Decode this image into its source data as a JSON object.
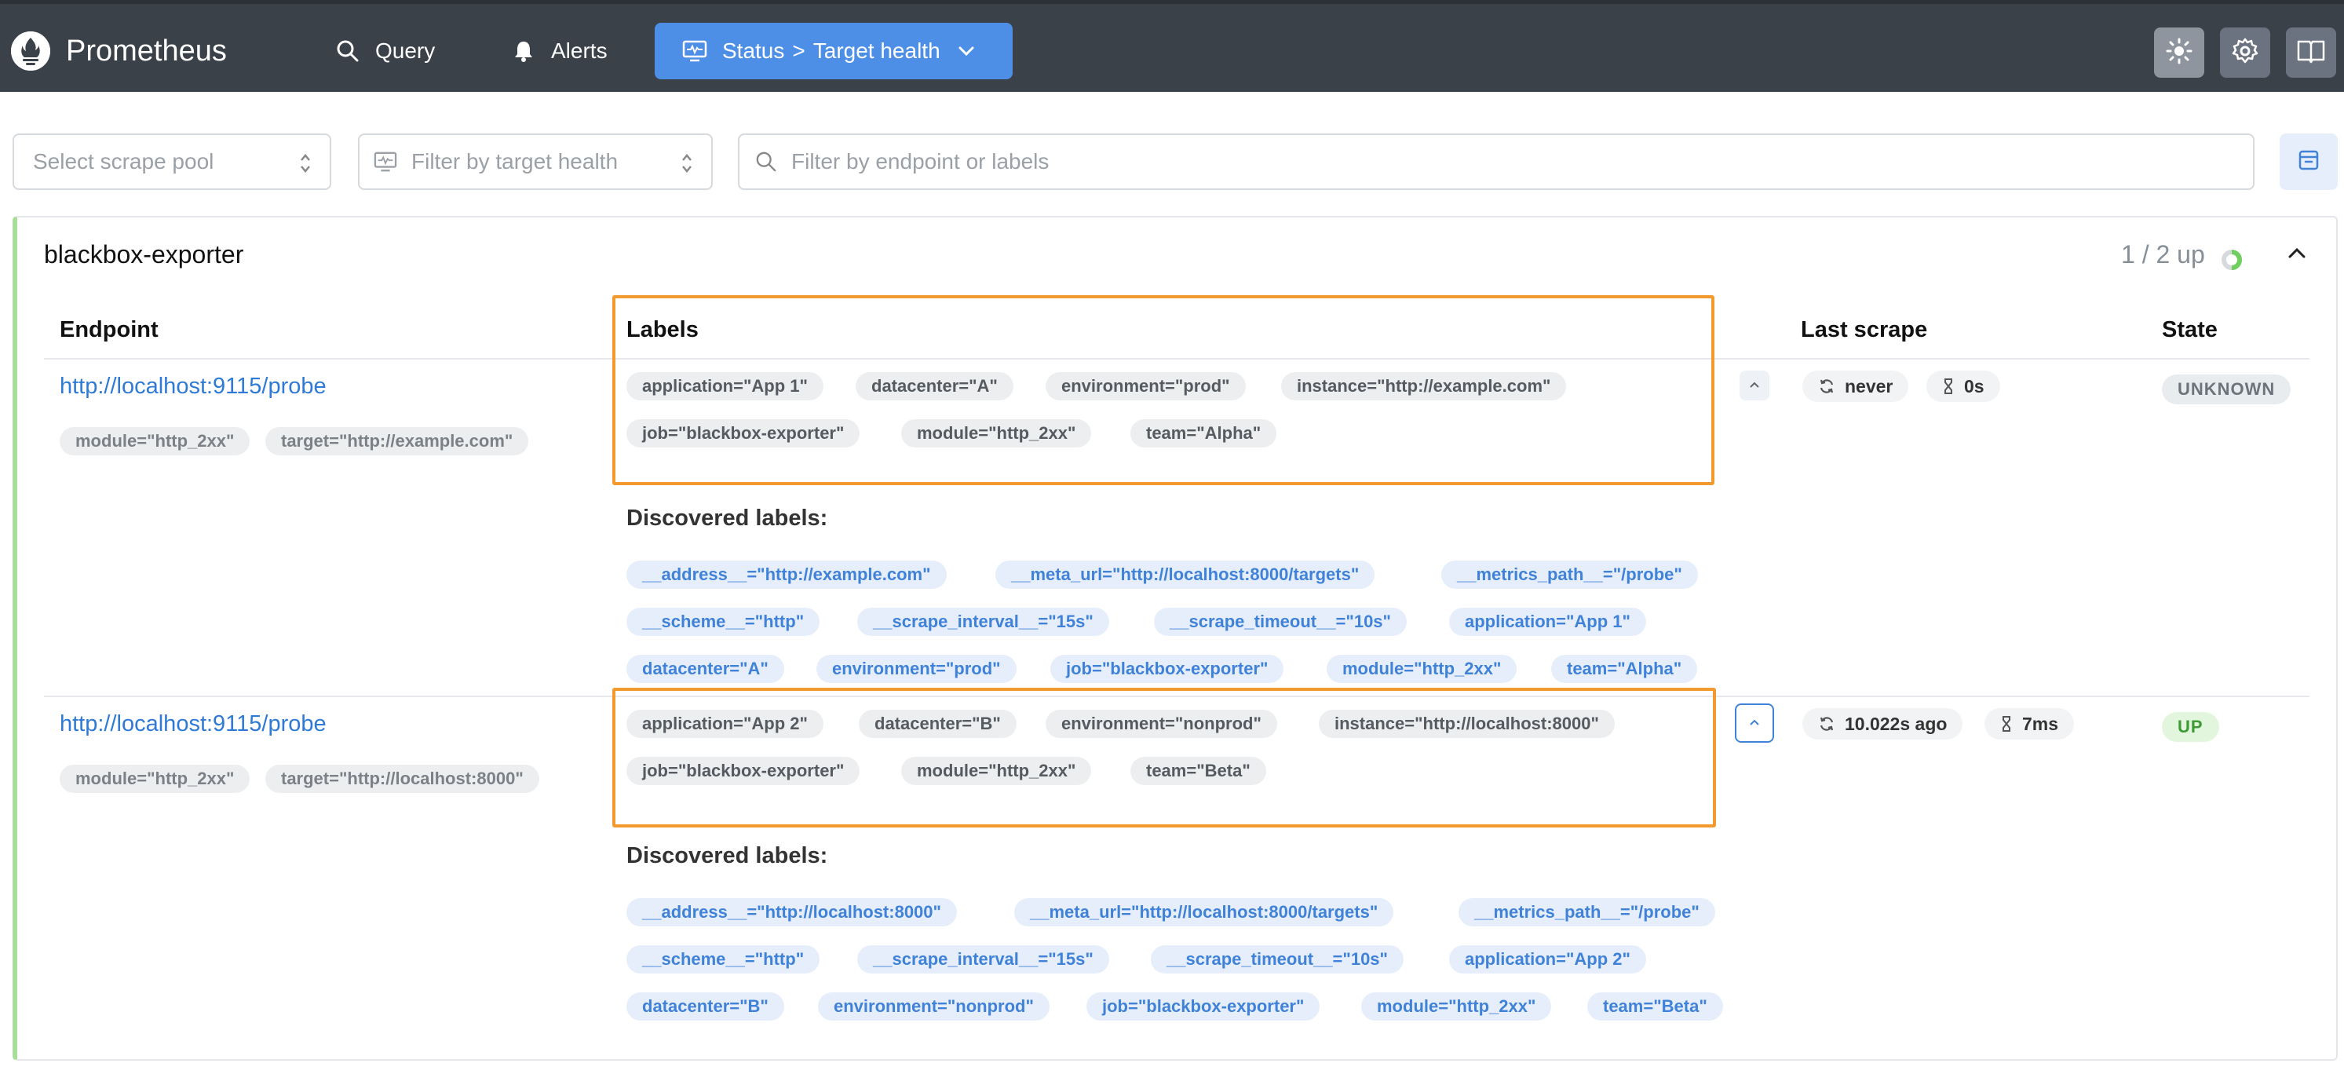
{
  "header": {
    "app_title": "Prometheus",
    "nav": {
      "query": "Query",
      "alerts": "Alerts",
      "status_part1": "Status",
      "status_sep": ">",
      "status_part2": "Target health"
    },
    "icons": [
      "sun-icon",
      "gear-icon",
      "book-icon"
    ]
  },
  "filters": {
    "scrape_pool_placeholder": "Select scrape pool",
    "health_placeholder": "Filter by target health",
    "search_placeholder": "Filter by endpoint or labels"
  },
  "pool": {
    "name": "blackbox-exporter",
    "up_count": "1 / 2 up",
    "up_fraction": 0.5,
    "columns": {
      "endpoint": "Endpoint",
      "labels": "Labels",
      "last_scrape": "Last scrape",
      "state": "State"
    },
    "discovered_title": "Discovered labels:",
    "targets": [
      {
        "endpoint": "http://localhost:9115/probe",
        "endpoint_params": [
          "module=\"http_2xx\"",
          "target=\"http://example.com\""
        ],
        "labels": [
          "application=\"App 1\"",
          "datacenter=\"A\"",
          "environment=\"prod\"",
          "instance=\"http://example.com\"",
          "job=\"blackbox-exporter\"",
          "module=\"http_2xx\"",
          "team=\"Alpha\""
        ],
        "discovered_labels": [
          "__address__=\"http://example.com\"",
          "__meta_url=\"http://localhost:8000/targets\"",
          "__metrics_path__=\"/probe\"",
          "__scheme__=\"http\"",
          "__scrape_interval__=\"15s\"",
          "__scrape_timeout__=\"10s\"",
          "application=\"App 1\"",
          "datacenter=\"A\"",
          "environment=\"prod\"",
          "job=\"blackbox-exporter\"",
          "module=\"http_2xx\"",
          "team=\"Alpha\""
        ],
        "last_scrape": "never",
        "duration": "0s",
        "state": "UNKNOWN"
      },
      {
        "endpoint": "http://localhost:9115/probe",
        "endpoint_params": [
          "module=\"http_2xx\"",
          "target=\"http://localhost:8000\""
        ],
        "labels": [
          "application=\"App 2\"",
          "datacenter=\"B\"",
          "environment=\"nonprod\"",
          "instance=\"http://localhost:8000\"",
          "job=\"blackbox-exporter\"",
          "module=\"http_2xx\"",
          "team=\"Beta\""
        ],
        "discovered_labels": [
          "__address__=\"http://localhost:8000\"",
          "__meta_url=\"http://localhost:8000/targets\"",
          "__metrics_path__=\"/probe\"",
          "__scheme__=\"http\"",
          "__scrape_interval__=\"15s\"",
          "__scrape_timeout__=\"10s\"",
          "application=\"App 2\"",
          "datacenter=\"B\"",
          "environment=\"nonprod\"",
          "job=\"blackbox-exporter\"",
          "module=\"http_2xx\"",
          "team=\"Beta\""
        ],
        "last_scrape": "10.022s ago",
        "duration": "7ms",
        "state": "UP"
      }
    ]
  },
  "colors": {
    "header_bg": "#3b4149",
    "nav_active": "#4d8fe6",
    "link": "#2f7ad6",
    "highlight": "#f39a2e",
    "up_green": "#3c9b35",
    "pool_border": "#a7df9a"
  }
}
